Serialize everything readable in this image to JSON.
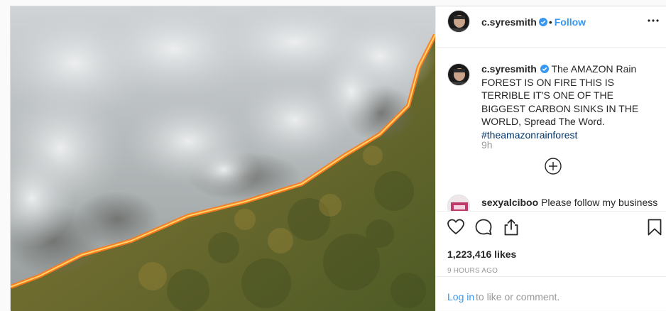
{
  "header": {
    "username": "c.syresmith",
    "separator": "•",
    "follow_label": "Follow"
  },
  "caption": {
    "username": "c.syresmith",
    "text": "The AMAZON Rain FOREST IS ON FIRE THIS IS TERRIBLE IT'S ONE OF THE BIGGEST CARBON SINKS IN THE WORLD, Spread The Word.",
    "hashtag": "#theamazonrainforest",
    "age": "9h"
  },
  "comment": {
    "username": "sexyalciboo",
    "text": "Please follow my business"
  },
  "engagement": {
    "likes": "1,223,416 likes",
    "posted": "9 HOURS AGO"
  },
  "login": {
    "link": "Log in",
    "text": "to like or comment."
  },
  "icons": {
    "header": [
      "avatar",
      "verified-badge-icon",
      "more-options-icon"
    ],
    "actions": [
      "heart-icon",
      "comment-bubble-icon",
      "share-icon",
      "bookmark-icon"
    ],
    "comments": [
      "load-more-plus-icon"
    ]
  },
  "colors": {
    "link_blue": "#3897f0",
    "hashtag": "#003569",
    "muted_text": "#999999",
    "border": "#efefef"
  }
}
